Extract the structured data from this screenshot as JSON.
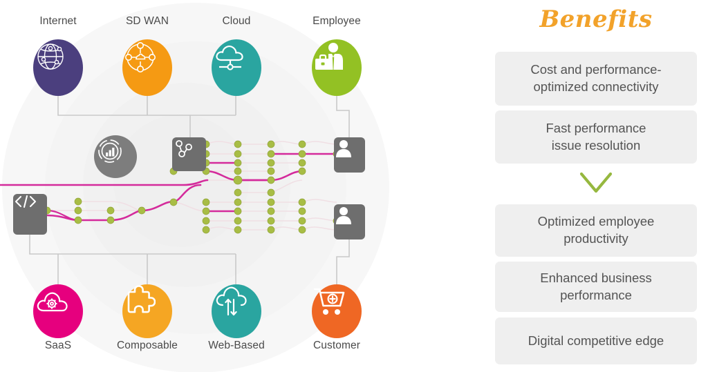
{
  "diagram": {
    "title": "network connectivity diagram",
    "top_nodes": [
      {
        "id": "internet",
        "label": "Internet",
        "icon": "globe-icon",
        "color": "#4b3f7e"
      },
      {
        "id": "sdwan",
        "label": "SD WAN",
        "icon": "sdwan-mesh-icon",
        "color": "#f59a13"
      },
      {
        "id": "cloud",
        "label": "Cloud",
        "icon": "cloud-network-icon",
        "color": "#2aa5a0"
      },
      {
        "id": "employee",
        "label": "Employee",
        "icon": "businessperson-icon",
        "color": "#93c124"
      }
    ],
    "bottom_nodes": [
      {
        "id": "saas",
        "label": "SaaS",
        "icon": "cloud-gear-icon",
        "color": "#e6007e"
      },
      {
        "id": "composable",
        "label": "Composable",
        "icon": "puzzle-piece-icon",
        "color": "#f5a623"
      },
      {
        "id": "webbased",
        "label": "Web-Based",
        "icon": "cloud-sync-icon",
        "color": "#2aa5a0"
      },
      {
        "id": "customer",
        "label": "Customer",
        "icon": "shopping-cart-plus-icon",
        "color": "#ef6724"
      }
    ],
    "core_nodes": [
      {
        "id": "analytics",
        "icon": "analytics-dial-icon",
        "color": "#7d7d7d"
      },
      {
        "id": "router",
        "icon": "network-router-icon",
        "color": "#6e6e6e"
      },
      {
        "id": "code",
        "icon": "code-brackets-icon",
        "color": "#6e6e6e"
      },
      {
        "id": "user-top",
        "icon": "user-avatar-icon",
        "color": "#6e6e6e"
      },
      {
        "id": "user-bottom",
        "icon": "user-avatar-icon",
        "color": "#6e6e6e"
      }
    ],
    "mesh": {
      "node_color": "#a8bd45",
      "active_path_color": "#d42a9b",
      "idle_path_color": "#e9cfd9",
      "connector_color": "#c9c9c9",
      "background_ring_color": "#f4f4f4"
    }
  },
  "benefits": {
    "title": "Benefits",
    "title_color": "#f2a22a",
    "chevron_color": "#96b83f",
    "cards": [
      {
        "text": "Cost and performance-\noptimized connectivity"
      },
      {
        "text": "Fast performance\nissue resolution"
      },
      {
        "text": "Optimized employee\nproductivity"
      },
      {
        "text": "Enhanced business\nperformance"
      },
      {
        "text": "Digital competitive edge"
      }
    ]
  }
}
